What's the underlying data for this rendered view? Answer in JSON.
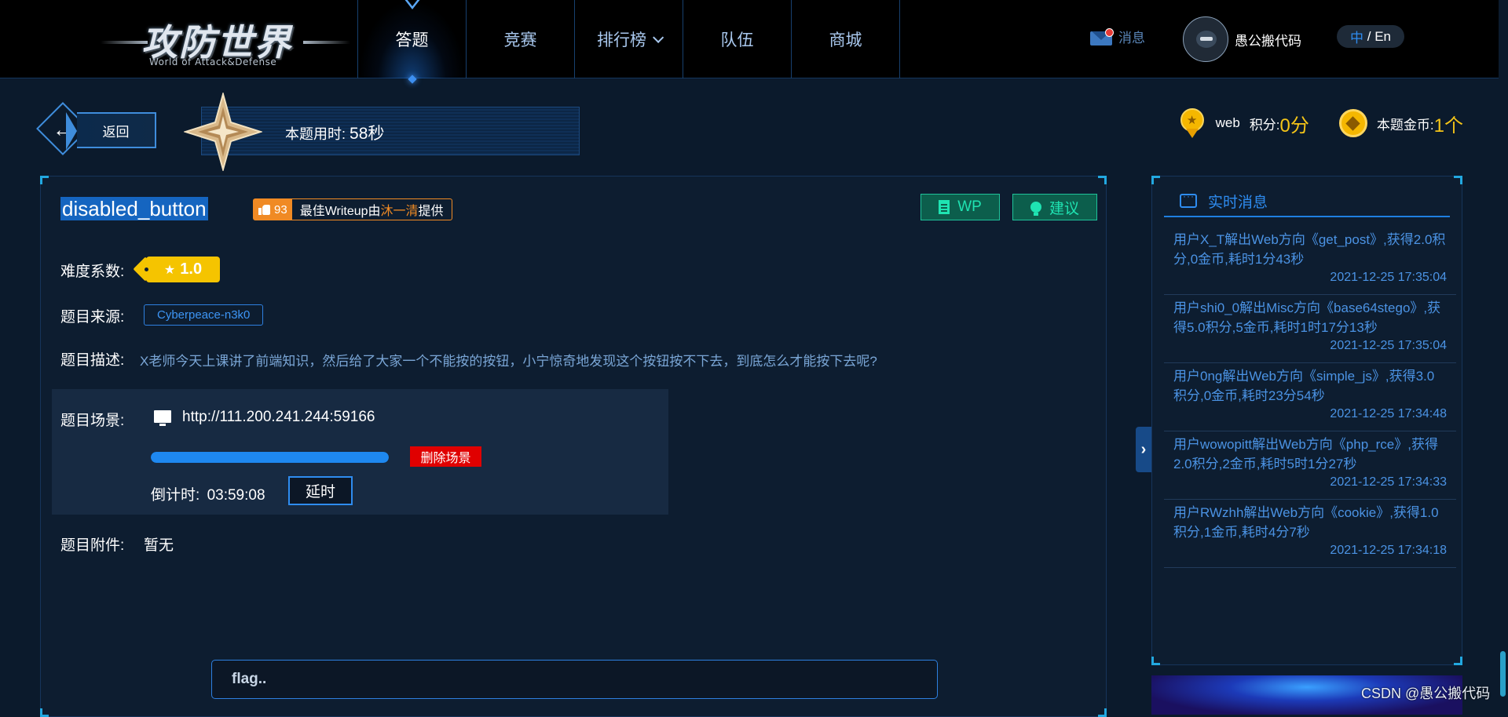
{
  "nav": {
    "logo_main": "攻防世界",
    "logo_sub": "World of Attack&Defense",
    "items": [
      {
        "label": "答题"
      },
      {
        "label": "竞赛"
      },
      {
        "label": "排行榜"
      },
      {
        "label": "队伍"
      },
      {
        "label": "商城"
      }
    ],
    "messages_label": "消息",
    "username": "愚公搬代码",
    "lang_zh": "中",
    "lang_sep": " / ",
    "lang_en": "En"
  },
  "subheader": {
    "back_label": "返回",
    "time_label": "本题用时: ",
    "time_value": "58秒",
    "category": "web",
    "score_label": "积分: ",
    "score_value": "0分",
    "coin_label": "本题金币: ",
    "coin_value": "1个"
  },
  "challenge": {
    "title": "disabled_button",
    "likes": "93",
    "writeup_prefix": "最佳Writeup由",
    "writeup_author": "沐一清",
    "writeup_suffix": "提供",
    "wp_button": "WP",
    "suggest_button": "建议",
    "difficulty_label": "难度系数:",
    "difficulty_value": "1.0",
    "source_label": "题目来源:",
    "source_value": "Cyberpeace-n3k0",
    "desc_label": "题目描述:",
    "desc_value": "X老师今天上课讲了前端知识，然后给了大家一个不能按的按钮，小宁惊奇地发现这个按钮按不下去，到底怎么才能按下去呢?",
    "scene_label": "题目场景:",
    "scene_url": "http://111.200.241.244:59166",
    "scene_progress": 1.0,
    "delete_scene": "删除场景",
    "countdown_label": "倒计时:",
    "countdown_value": "03:59:08",
    "delay_button": "延时",
    "attach_label": "题目附件:",
    "attach_value": "暂无",
    "flag_placeholder": "flag.."
  },
  "feed": {
    "title": "实时消息",
    "items": [
      {
        "text": "用户X_T解出Web方向《get_post》,获得2.0积分,0金币,耗时1分43秒",
        "date": "2021-12-25 17:35:04"
      },
      {
        "text": "用户shi0_0解出Misc方向《base64stego》,获得5.0积分,5金币,耗时1时17分13秒",
        "date": "2021-12-25 17:35:04"
      },
      {
        "text": "用户0ng解出Web方向《simple_js》,获得3.0积分,0金币,耗时23分54秒",
        "date": "2021-12-25 17:34:48"
      },
      {
        "text": "用户wowopitt解出Web方向《php_rce》,获得2.0积分,2金币,耗时5时1分27秒",
        "date": "2021-12-25 17:34:33"
      },
      {
        "text": "用户RWzhh解出Web方向《cookie》,获得1.0积分,1金币,耗时4分7秒",
        "date": "2021-12-25 17:34:18"
      }
    ]
  },
  "watermark": "CSDN @愚公搬代码",
  "colors": {
    "accent": "#2e8cf0",
    "gold": "#f5c518",
    "danger": "#e00000",
    "wp_green": "#1fe3b2"
  }
}
